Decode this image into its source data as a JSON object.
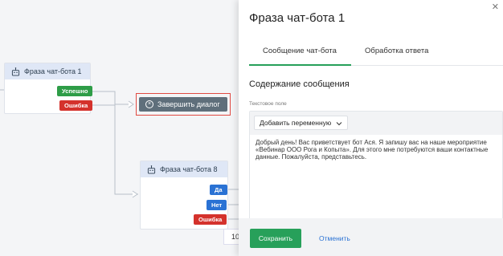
{
  "canvas": {
    "node1": {
      "title": "Фраза чат-бота 1",
      "tag_success": "Успешно",
      "tag_error": "Ошибка"
    },
    "finish_dialog": {
      "label": "Завершить диалог"
    },
    "node8": {
      "title": "Фраза чат-бота 8",
      "tag_yes": "Да",
      "tag_no": "Нет",
      "tag_error": "Ошибка"
    },
    "zoom_text": "10"
  },
  "panel": {
    "title": "Фраза чат-бота 1",
    "close_icon": "close-icon",
    "tabs": [
      {
        "label": "Сообщение чат-бота",
        "active": true
      },
      {
        "label": "Обработка ответа",
        "active": false
      }
    ],
    "section_title": "Содержание сообщения",
    "field_label": "Текстовое поле",
    "add_variable_label": "Добавить переменную",
    "message_text": "Добрый день! Вас приветствует бот Ася. Я запишу вас на наше мероприятие «Вебинар ООО Рога и Копыта». Для этого мне потребуются ваши контактные данные. Пожалуйста, представьтесь.",
    "save_label": "Сохранить",
    "cancel_label": "Отменить"
  },
  "colors": {
    "accent": "#27a05a",
    "error": "#d4322c",
    "link": "#2a72d4"
  }
}
